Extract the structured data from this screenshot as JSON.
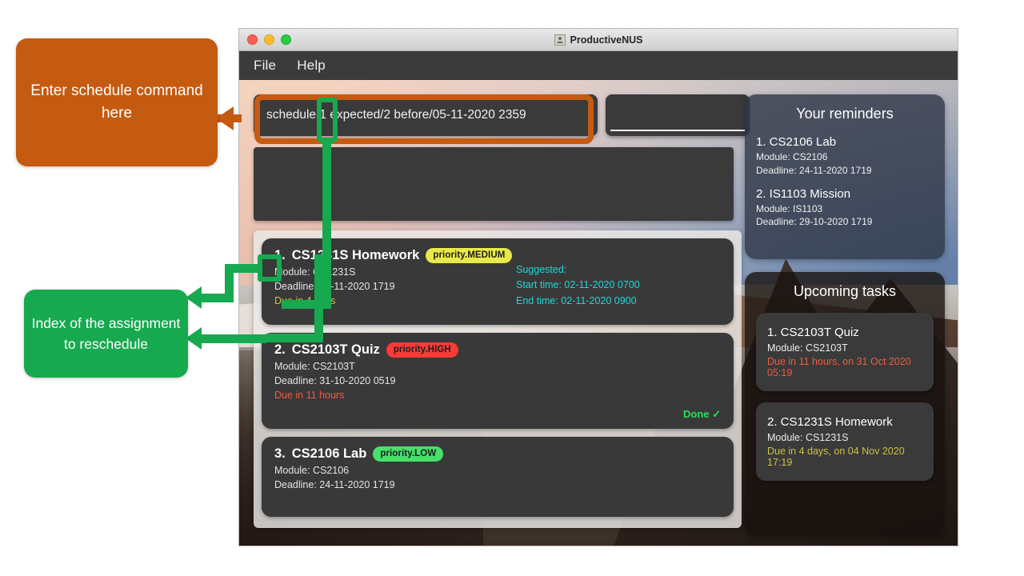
{
  "window": {
    "title": "ProductiveNUS",
    "app_icon": "user-icon",
    "traffic_lights": [
      "close-red",
      "minimize-yellow",
      "maximize-green"
    ],
    "menu": [
      "File",
      "Help"
    ]
  },
  "command": {
    "value": "schedule 1 expected/2 before/05-11-2020 2359",
    "highlighted_token": "1"
  },
  "result_box": {
    "text": ""
  },
  "assignments": [
    {
      "index": "1.",
      "title": "CS1231S Homework",
      "priority_label": "priority.MEDIUM",
      "priority_color": "#e8ea49",
      "module": "Module: CS1231S",
      "deadline": "Deadline: 04-11-2020 1719",
      "due": "Due in 4 days",
      "due_color": "#cfc04a",
      "suggested_header": "Suggested:",
      "suggested_start": "Start time: 02-11-2020 0700",
      "suggested_end": "End time: 02-11-2020 0900",
      "done": ""
    },
    {
      "index": "2.",
      "title": "CS2103T Quiz",
      "priority_label": "priority.HIGH",
      "priority_color": "#fc3a36",
      "module": "Module: CS2103T",
      "deadline": "Deadline: 31-10-2020 0519",
      "due": "Due in 11 hours",
      "due_color": "#f05b42",
      "suggested_header": "",
      "suggested_start": "",
      "suggested_end": "",
      "done": "Done ✓"
    },
    {
      "index": "3.",
      "title": "CS2106 Lab",
      "priority_label": "priority.LOW",
      "priority_color": "#47e06a",
      "module": "Module: CS2106",
      "deadline": "Deadline: 24-11-2020 1719",
      "due": "",
      "due_color": "#cfc04a",
      "suggested_header": "",
      "suggested_start": "",
      "suggested_end": "",
      "done": ""
    }
  ],
  "reminders": {
    "title": "Your reminders",
    "items": [
      {
        "head": "1.  CS2106 Lab",
        "module": "Module: CS2106",
        "deadline": "Deadline: 24-11-2020 1719"
      },
      {
        "head": "2.  IS1103 Mission",
        "module": "Module: IS1103",
        "deadline": "Deadline: 29-10-2020 1719"
      }
    ]
  },
  "upcoming": {
    "title": "Upcoming tasks",
    "items": [
      {
        "head": "1.  CS2103T Quiz",
        "module": "Module: CS2103T",
        "due": "Due in 11 hours, on 31 Oct 2020 05:19",
        "due_color": "#f05b42"
      },
      {
        "head": "2.  CS1231S Homework",
        "module": "Module: CS1231S",
        "due": "Due in 4 days, on 04 Nov 2020 17:19",
        "due_color": "#cfc04a"
      }
    ]
  },
  "annotations": {
    "orange": {
      "text": "Enter schedule command here",
      "color": "#c55a11"
    },
    "green": {
      "text": "Index of the assignment to reschedule",
      "color": "#17a94f"
    }
  }
}
